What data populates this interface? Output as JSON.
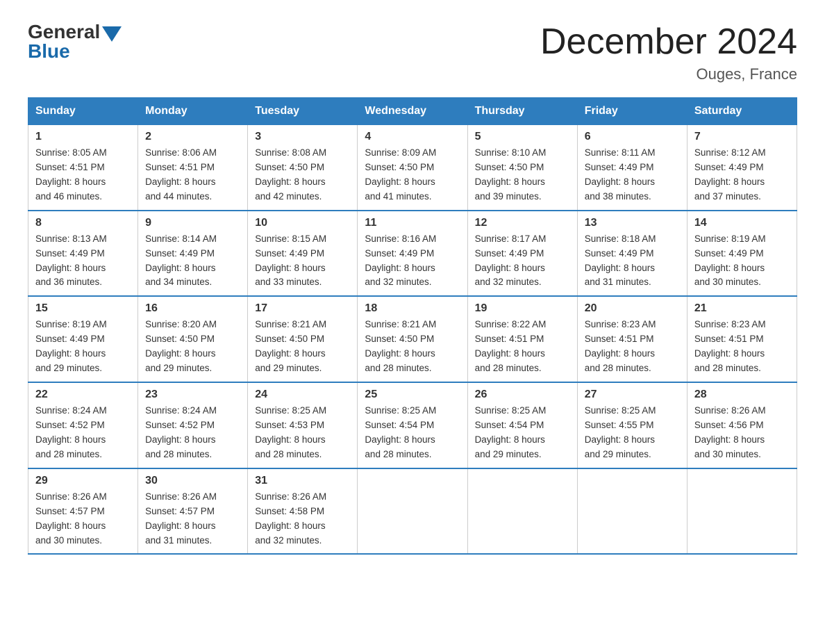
{
  "header": {
    "logo_general": "General",
    "logo_blue": "Blue",
    "title": "December 2024",
    "location": "Ouges, France"
  },
  "days_of_week": [
    "Sunday",
    "Monday",
    "Tuesday",
    "Wednesday",
    "Thursday",
    "Friday",
    "Saturday"
  ],
  "weeks": [
    [
      {
        "day": "1",
        "sunrise": "8:05 AM",
        "sunset": "4:51 PM",
        "daylight": "8 hours and 46 minutes."
      },
      {
        "day": "2",
        "sunrise": "8:06 AM",
        "sunset": "4:51 PM",
        "daylight": "8 hours and 44 minutes."
      },
      {
        "day": "3",
        "sunrise": "8:08 AM",
        "sunset": "4:50 PM",
        "daylight": "8 hours and 42 minutes."
      },
      {
        "day": "4",
        "sunrise": "8:09 AM",
        "sunset": "4:50 PM",
        "daylight": "8 hours and 41 minutes."
      },
      {
        "day": "5",
        "sunrise": "8:10 AM",
        "sunset": "4:50 PM",
        "daylight": "8 hours and 39 minutes."
      },
      {
        "day": "6",
        "sunrise": "8:11 AM",
        "sunset": "4:49 PM",
        "daylight": "8 hours and 38 minutes."
      },
      {
        "day": "7",
        "sunrise": "8:12 AM",
        "sunset": "4:49 PM",
        "daylight": "8 hours and 37 minutes."
      }
    ],
    [
      {
        "day": "8",
        "sunrise": "8:13 AM",
        "sunset": "4:49 PM",
        "daylight": "8 hours and 36 minutes."
      },
      {
        "day": "9",
        "sunrise": "8:14 AM",
        "sunset": "4:49 PM",
        "daylight": "8 hours and 34 minutes."
      },
      {
        "day": "10",
        "sunrise": "8:15 AM",
        "sunset": "4:49 PM",
        "daylight": "8 hours and 33 minutes."
      },
      {
        "day": "11",
        "sunrise": "8:16 AM",
        "sunset": "4:49 PM",
        "daylight": "8 hours and 32 minutes."
      },
      {
        "day": "12",
        "sunrise": "8:17 AM",
        "sunset": "4:49 PM",
        "daylight": "8 hours and 32 minutes."
      },
      {
        "day": "13",
        "sunrise": "8:18 AM",
        "sunset": "4:49 PM",
        "daylight": "8 hours and 31 minutes."
      },
      {
        "day": "14",
        "sunrise": "8:19 AM",
        "sunset": "4:49 PM",
        "daylight": "8 hours and 30 minutes."
      }
    ],
    [
      {
        "day": "15",
        "sunrise": "8:19 AM",
        "sunset": "4:49 PM",
        "daylight": "8 hours and 29 minutes."
      },
      {
        "day": "16",
        "sunrise": "8:20 AM",
        "sunset": "4:50 PM",
        "daylight": "8 hours and 29 minutes."
      },
      {
        "day": "17",
        "sunrise": "8:21 AM",
        "sunset": "4:50 PM",
        "daylight": "8 hours and 29 minutes."
      },
      {
        "day": "18",
        "sunrise": "8:21 AM",
        "sunset": "4:50 PM",
        "daylight": "8 hours and 28 minutes."
      },
      {
        "day": "19",
        "sunrise": "8:22 AM",
        "sunset": "4:51 PM",
        "daylight": "8 hours and 28 minutes."
      },
      {
        "day": "20",
        "sunrise": "8:23 AM",
        "sunset": "4:51 PM",
        "daylight": "8 hours and 28 minutes."
      },
      {
        "day": "21",
        "sunrise": "8:23 AM",
        "sunset": "4:51 PM",
        "daylight": "8 hours and 28 minutes."
      }
    ],
    [
      {
        "day": "22",
        "sunrise": "8:24 AM",
        "sunset": "4:52 PM",
        "daylight": "8 hours and 28 minutes."
      },
      {
        "day": "23",
        "sunrise": "8:24 AM",
        "sunset": "4:52 PM",
        "daylight": "8 hours and 28 minutes."
      },
      {
        "day": "24",
        "sunrise": "8:25 AM",
        "sunset": "4:53 PM",
        "daylight": "8 hours and 28 minutes."
      },
      {
        "day": "25",
        "sunrise": "8:25 AM",
        "sunset": "4:54 PM",
        "daylight": "8 hours and 28 minutes."
      },
      {
        "day": "26",
        "sunrise": "8:25 AM",
        "sunset": "4:54 PM",
        "daylight": "8 hours and 29 minutes."
      },
      {
        "day": "27",
        "sunrise": "8:25 AM",
        "sunset": "4:55 PM",
        "daylight": "8 hours and 29 minutes."
      },
      {
        "day": "28",
        "sunrise": "8:26 AM",
        "sunset": "4:56 PM",
        "daylight": "8 hours and 30 minutes."
      }
    ],
    [
      {
        "day": "29",
        "sunrise": "8:26 AM",
        "sunset": "4:57 PM",
        "daylight": "8 hours and 30 minutes."
      },
      {
        "day": "30",
        "sunrise": "8:26 AM",
        "sunset": "4:57 PM",
        "daylight": "8 hours and 31 minutes."
      },
      {
        "day": "31",
        "sunrise": "8:26 AM",
        "sunset": "4:58 PM",
        "daylight": "8 hours and 32 minutes."
      },
      null,
      null,
      null,
      null
    ]
  ],
  "labels": {
    "sunrise": "Sunrise:",
    "sunset": "Sunset:",
    "daylight": "Daylight:"
  }
}
